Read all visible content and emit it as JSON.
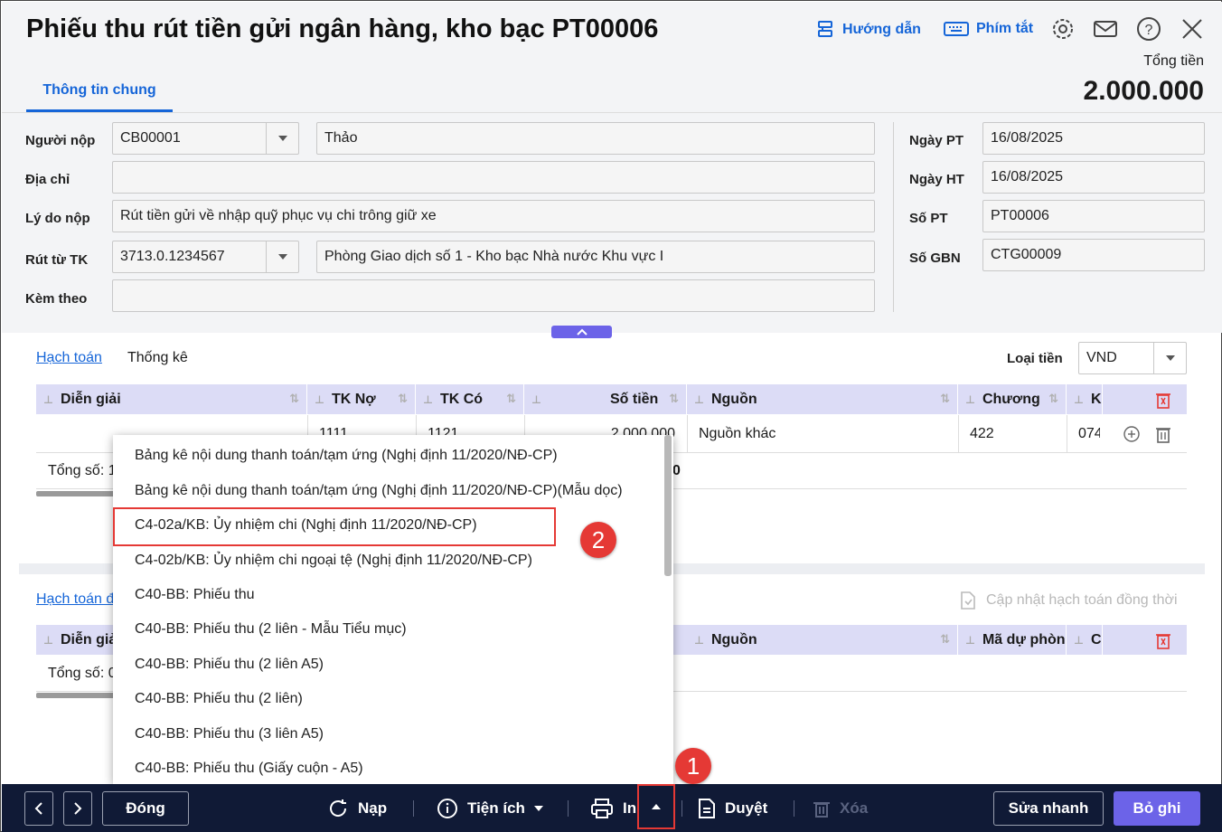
{
  "header": {
    "title": "Phiếu thu rút tiền gửi ngân hàng, kho bạc PT00006",
    "guide_label": "Hướng dẫn",
    "shortcut_label": "Phím tắt",
    "total_label": "Tổng tiền",
    "total_value": "2.000.000",
    "tab_general": "Thông tin chung"
  },
  "form": {
    "payer_label": "Người nộp",
    "payer_code": "CB00001",
    "payer_name": "Thảo",
    "address_label": "Địa chỉ",
    "address_value": "",
    "reason_label": "Lý do nộp",
    "reason_value": "Rút tiền gửi về nhập quỹ phục vụ chi trông giữ xe",
    "account_label": "Rút từ TK",
    "account_value": "3713.0.1234567",
    "account_name": "Phòng Giao dịch số 1 - Kho bạc Nhà nước Khu vực I",
    "attach_label": "Kèm theo",
    "attach_value": "",
    "date_pt_label": "Ngày PT",
    "date_pt_value": "16/08/2025",
    "date_ht_label": "Ngày HT",
    "date_ht_value": "16/08/2025",
    "so_pt_label": "Số PT",
    "so_pt_value": "PT00006",
    "so_gbn_label": "Số GBN",
    "so_gbn_value": "CTG00009"
  },
  "detail": {
    "tab_accounting": "Hạch toán",
    "tab_stats": "Thống kê",
    "currency_label": "Loại tiền",
    "currency_value": "VND",
    "columns": [
      "Diễn giải",
      "TK Nợ",
      "TK Có",
      "Số tiền",
      "Nguồn",
      "Chương",
      "K"
    ],
    "row": {
      "tk_no": "1111",
      "tk_co": "1121",
      "amount": "2.000.000",
      "source": "Nguồn khác",
      "chapter": "422",
      "k": "074"
    },
    "total_label": "Tổng số: 1",
    "total_amount_tail": "0"
  },
  "detail2": {
    "tab_accounting": "Hạch toán đồng thời",
    "update_label": "Cập nhật hạch toán đồng thời",
    "columns": [
      "Diễn giải",
      "Nguồn",
      "Mã dự phòng",
      "C"
    ],
    "total_label": "Tổng số: 0"
  },
  "print_menu": {
    "items": [
      "Bảng kê nội dung thanh toán/tạm ứng (Nghị định 11/2020/NĐ-CP)",
      "Bảng kê nội dung thanh toán/tạm ứng (Nghị định 11/2020/NĐ-CP)(Mẫu dọc)",
      "C4-02a/KB: Ủy nhiệm chi (Nghị định 11/2020/NĐ-CP)",
      "C4-02b/KB: Ủy nhiệm chi ngoại tệ (Nghị định 11/2020/NĐ-CP)",
      "C40-BB: Phiếu thu",
      "C40-BB: Phiếu thu (2 liên - Mẫu Tiểu mục)",
      "C40-BB: Phiếu thu (2 liên A5)",
      "C40-BB: Phiếu thu (2 liên)",
      "C40-BB: Phiếu thu (3 liên A5)",
      "C40-BB: Phiếu thu (Giấy cuộn - A5)"
    ]
  },
  "annotations": {
    "badge1": "1",
    "badge2": "2"
  },
  "footer": {
    "close_label": "Đóng",
    "load_label": "Nạp",
    "utility_label": "Tiện ích",
    "print_label": "In",
    "approve_label": "Duyệt",
    "delete_label": "Xóa",
    "quick_edit_label": "Sửa nhanh",
    "save_label": "Bỏ ghi"
  },
  "colors": {
    "accent": "#1565d8",
    "primary_button": "#6c63e8",
    "footer_bg": "#101a36",
    "highlight": "#e53935"
  }
}
